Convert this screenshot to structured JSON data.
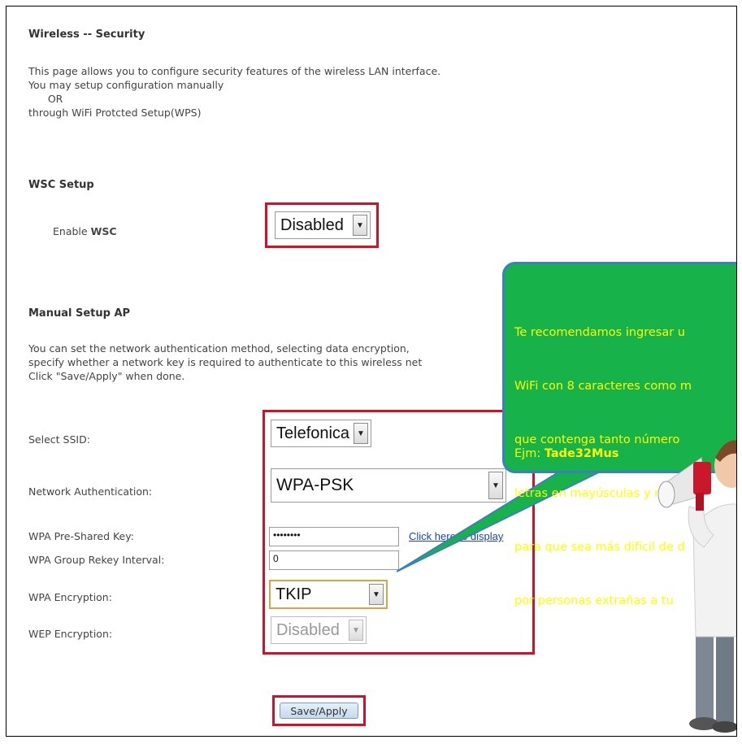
{
  "page": {
    "title": "Wireless -- Security",
    "intro_lines": [
      "This page allows you to configure security features of the wireless LAN interface.",
      "You may setup configuration manually",
      "      OR",
      "through WiFi Protcted Setup(WPS)"
    ]
  },
  "wsc": {
    "heading": "WSC Setup",
    "enable_label_prefix": "Enable ",
    "enable_label_bold": "WSC",
    "enable_value": "Disabled"
  },
  "manual": {
    "heading": "Manual Setup AP",
    "desc_lines": [
      "You can set the network authentication method, selecting data encryption,",
      "specify whether a network key is required to authenticate to this wireless net",
      "Click \"Save/Apply\" when done."
    ],
    "ssid_label": "Select SSID:",
    "ssid_value": "Telefonica",
    "auth_label": "Network Authentication:",
    "auth_value": "WPA-PSK",
    "psk_label": "WPA Pre-Shared Key:",
    "psk_value": "••••••••",
    "psk_link": "Click here to display",
    "rekey_label": "WPA Group Rekey Interval:",
    "rekey_value": "0",
    "wpa_enc_label": "WPA Encryption:",
    "wpa_enc_value": "TKIP",
    "wep_enc_label": "WEP Encryption:",
    "wep_enc_value": "Disabled",
    "save_label": "Save/Apply"
  },
  "callout": {
    "lines": [
      "Te recomendamos ingresar u",
      "WiFi con 8 caracteres como m",
      "que contenga tanto número",
      "letras en mayúsculas y min",
      "para que sea más difícil de d",
      "por personas extrañas a tu"
    ],
    "example_prefix": "Ejm: ",
    "example_value": "Tade32Mus"
  },
  "colors": {
    "highlight": "#d0112b",
    "bubble": "#17b24a",
    "bubble_text": "#ffff00",
    "link": "#1f3fbf"
  }
}
